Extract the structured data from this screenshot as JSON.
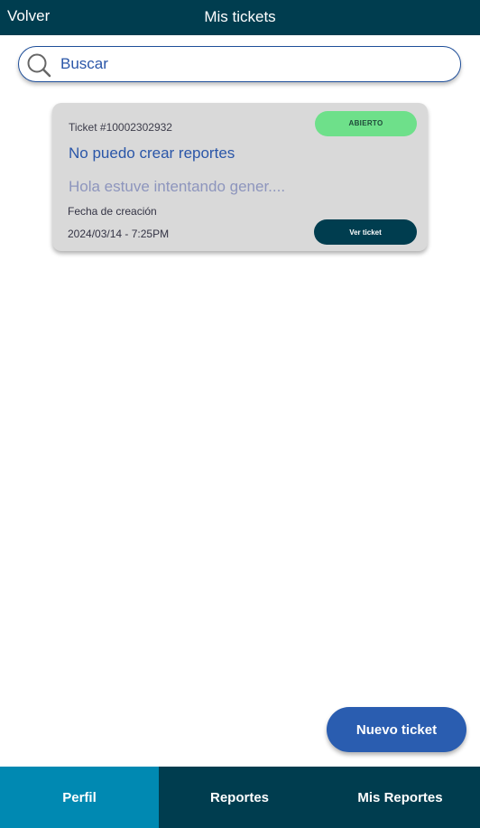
{
  "header": {
    "back_label": "Volver",
    "title": "Mis tickets"
  },
  "search": {
    "placeholder": "Buscar",
    "icon": "search-icon"
  },
  "tickets": [
    {
      "number": "Ticket #10002302932",
      "status": "ABIERTO",
      "subject": "No puedo crear reportes",
      "preview": "Hola estuve intentando gener....",
      "date_label": "Fecha de creación",
      "date": "2024/03/14 - 7:25PM",
      "action_label": "Ver ticket"
    }
  ],
  "new_ticket_label": "Nuevo ticket",
  "bottom_nav": {
    "items": [
      {
        "label": "Perfil",
        "active": true
      },
      {
        "label": "Reportes",
        "active": false
      },
      {
        "label": "Mis Reportes",
        "active": false
      }
    ]
  },
  "colors": {
    "header_bg": "#003d4f",
    "accent_blue": "#2a5db0",
    "active_tab": "#0089b2",
    "status_open": "#6ee08a",
    "card_bg": "#d9d9d9"
  }
}
